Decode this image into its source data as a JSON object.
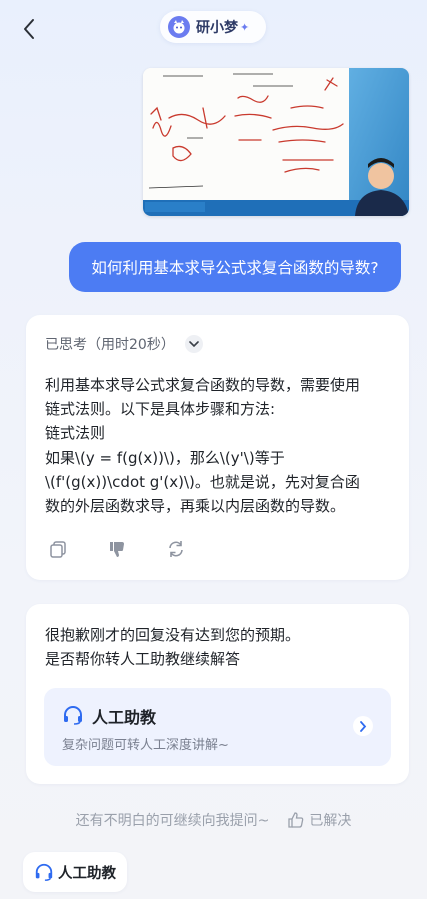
{
  "header": {
    "brand_name": "研小梦",
    "brand_spark": "✦",
    "back_icon": "chevron-left-icon"
  },
  "video": {
    "thumbnail": "math-lesson-video-thumbnail"
  },
  "user_message": "如何利用基本求导公式求复合函数的导数?",
  "answer": {
    "thinking_label": "已思考（用时20秒）",
    "lines": [
      "利用基本求导公式求复合函数的导数，需要使用",
      "链式法则。以下是具体步骤和方法:",
      "链式法则",
      "如果\\(y = f(g(x))\\)，那么\\(y'\\)等于",
      "\\(f'(g(x))\\cdot g'(x)\\)。也就是说，先对复合函",
      "数的外层函数求导，再乘以内层函数的导数。"
    ],
    "actions": [
      "copy-icon",
      "thumbs-down-icon",
      "refresh-icon"
    ]
  },
  "apology": {
    "line1": "很抱歉刚才的回复没有达到您的预期。",
    "line2": "是否帮你转人工助教继续解答",
    "assistant_title": "人工助教",
    "assistant_sub": "复杂问题可转人工深度讲解~"
  },
  "follow_up": {
    "prompt": "还有不明白的可继续向我提问~",
    "resolved_label": "已解决"
  },
  "bottom": {
    "human_assistant_label": "人工助教"
  },
  "colors": {
    "accent": "#4c7cf3",
    "user_bubble": "#4c7cf3",
    "assistant_box": "#eef2fe"
  }
}
